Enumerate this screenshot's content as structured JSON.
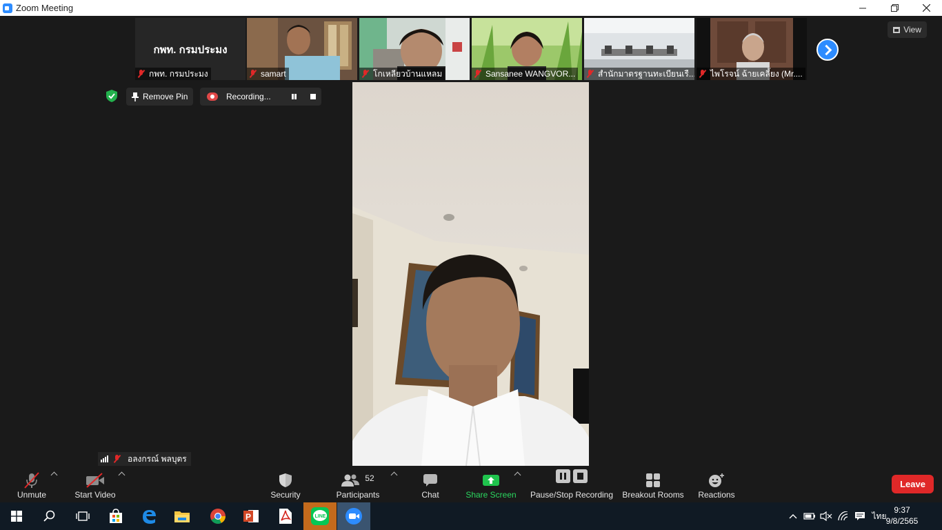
{
  "window": {
    "title": "Zoom Meeting",
    "controls": [
      "minimize",
      "restore",
      "close"
    ]
  },
  "view_button": {
    "label": "View"
  },
  "thumbnails": [
    {
      "name": "กพท. กรมประมง",
      "display_text": "กพท. กรมประมง",
      "muted": true,
      "video": false
    },
    {
      "name": "samart",
      "muted": true,
      "video": true
    },
    {
      "name": "โกเหลียวบ้านแหลม",
      "muted": true,
      "video": true
    },
    {
      "name": "Sansanee WANGVOR...",
      "muted": true,
      "video": true
    },
    {
      "name": "สำนักมาตรฐานทะเบียนเรื...",
      "muted": true,
      "video": true
    },
    {
      "name": "ไพโรจน์ ฉ้ายเคลี้ยง (Mr....",
      "muted": true,
      "video": true
    }
  ],
  "pin": {
    "label": "Remove Pin"
  },
  "recording": {
    "label": "Recording..."
  },
  "active_speaker": {
    "name": "อลงกรณ์ พลบุตร"
  },
  "toolbar": {
    "unmute": "Unmute",
    "start_video": "Start Video",
    "security": "Security",
    "participants": "Participants",
    "participants_count": "52",
    "chat": "Chat",
    "share_screen": "Share Screen",
    "pause_stop_recording": "Pause/Stop Recording",
    "breakout_rooms": "Breakout Rooms",
    "reactions": "Reactions",
    "leave": "Leave"
  },
  "taskbar": {
    "apps": [
      "windows-start",
      "search",
      "task-view",
      "store",
      "edge",
      "file-explorer",
      "chrome",
      "powerpoint",
      "acrobat",
      "line",
      "zoom"
    ],
    "active_apps": [
      "line",
      "zoom"
    ],
    "language": "ไทย",
    "time": "9:37",
    "date": "9/8/2565"
  },
  "colors": {
    "background": "#1a1a1a",
    "accent_blue": "#2d8cff",
    "leave_red": "#e02828",
    "share_green": "#1fc34d",
    "taskbar": "#101a24"
  }
}
